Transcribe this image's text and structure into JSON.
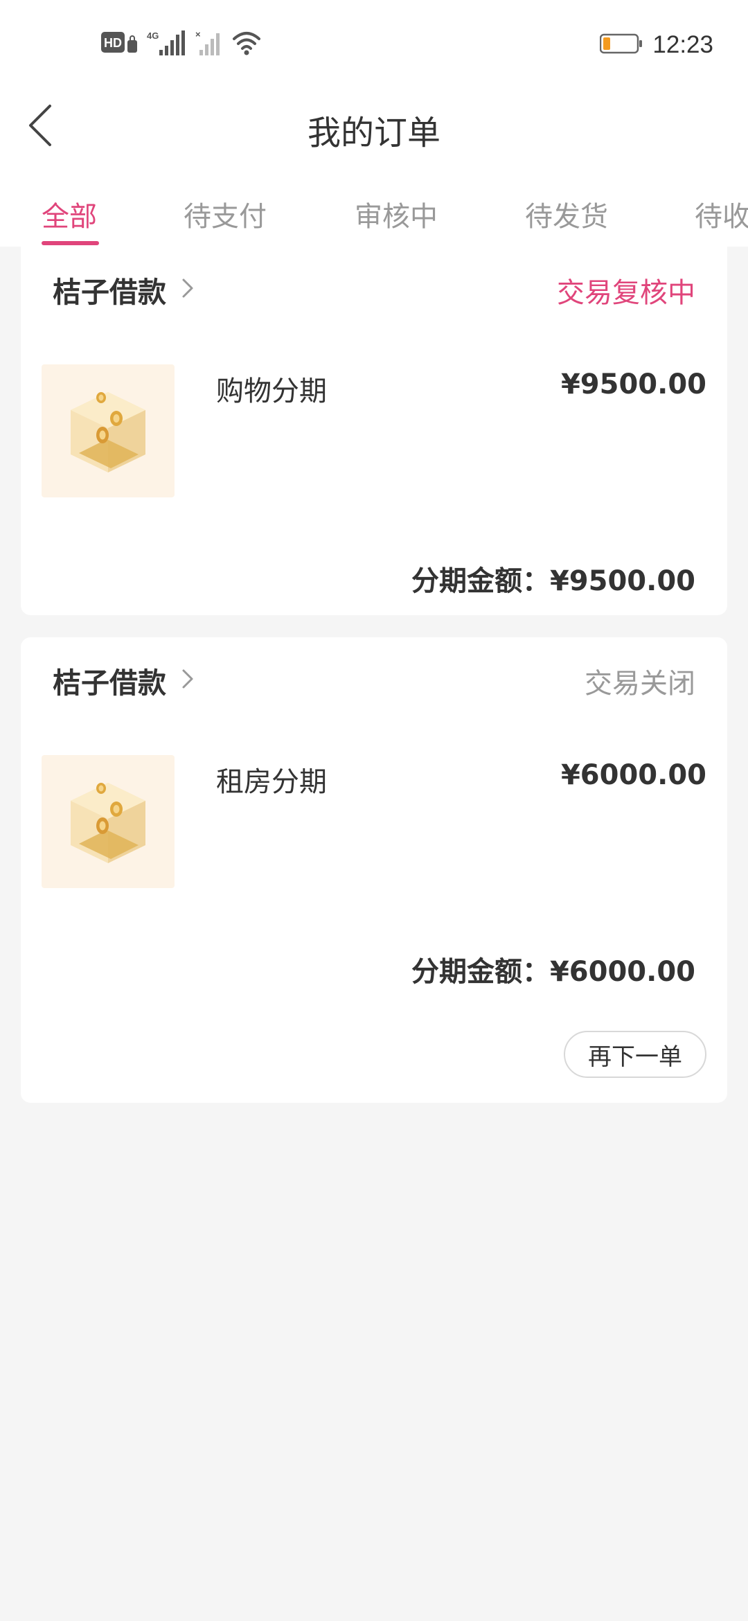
{
  "statusbar": {
    "time": "12:23",
    "hd_label": "HD",
    "network_label": "4G",
    "battery_color": "#f39a1f"
  },
  "header": {
    "title": "我的订单",
    "back_icon": "chevron-left-icon"
  },
  "tabs": [
    {
      "label": "全部",
      "active": true
    },
    {
      "label": "待支付",
      "active": false
    },
    {
      "label": "审核中",
      "active": false
    },
    {
      "label": "待发货",
      "active": false
    },
    {
      "label": "待收",
      "active": false
    }
  ],
  "orders": [
    {
      "shop": "桔子借款",
      "status": "交易复核中",
      "status_color": "#e0457b",
      "product": "购物分期",
      "price": "¥9500.00",
      "amount_label": "分期金额：",
      "amount": "¥9500.00"
    },
    {
      "shop": "桔子借款",
      "status": "交易关闭",
      "status_color": "#999999",
      "product": "租房分期",
      "price": "¥6000.00",
      "amount_label": "分期金额：",
      "amount": "¥6000.00",
      "action": "再下一单"
    }
  ],
  "colors": {
    "accent": "#e0457b",
    "background": "#f5f5f5",
    "card": "#ffffff",
    "thumb_bg": "#fdf3e6"
  }
}
